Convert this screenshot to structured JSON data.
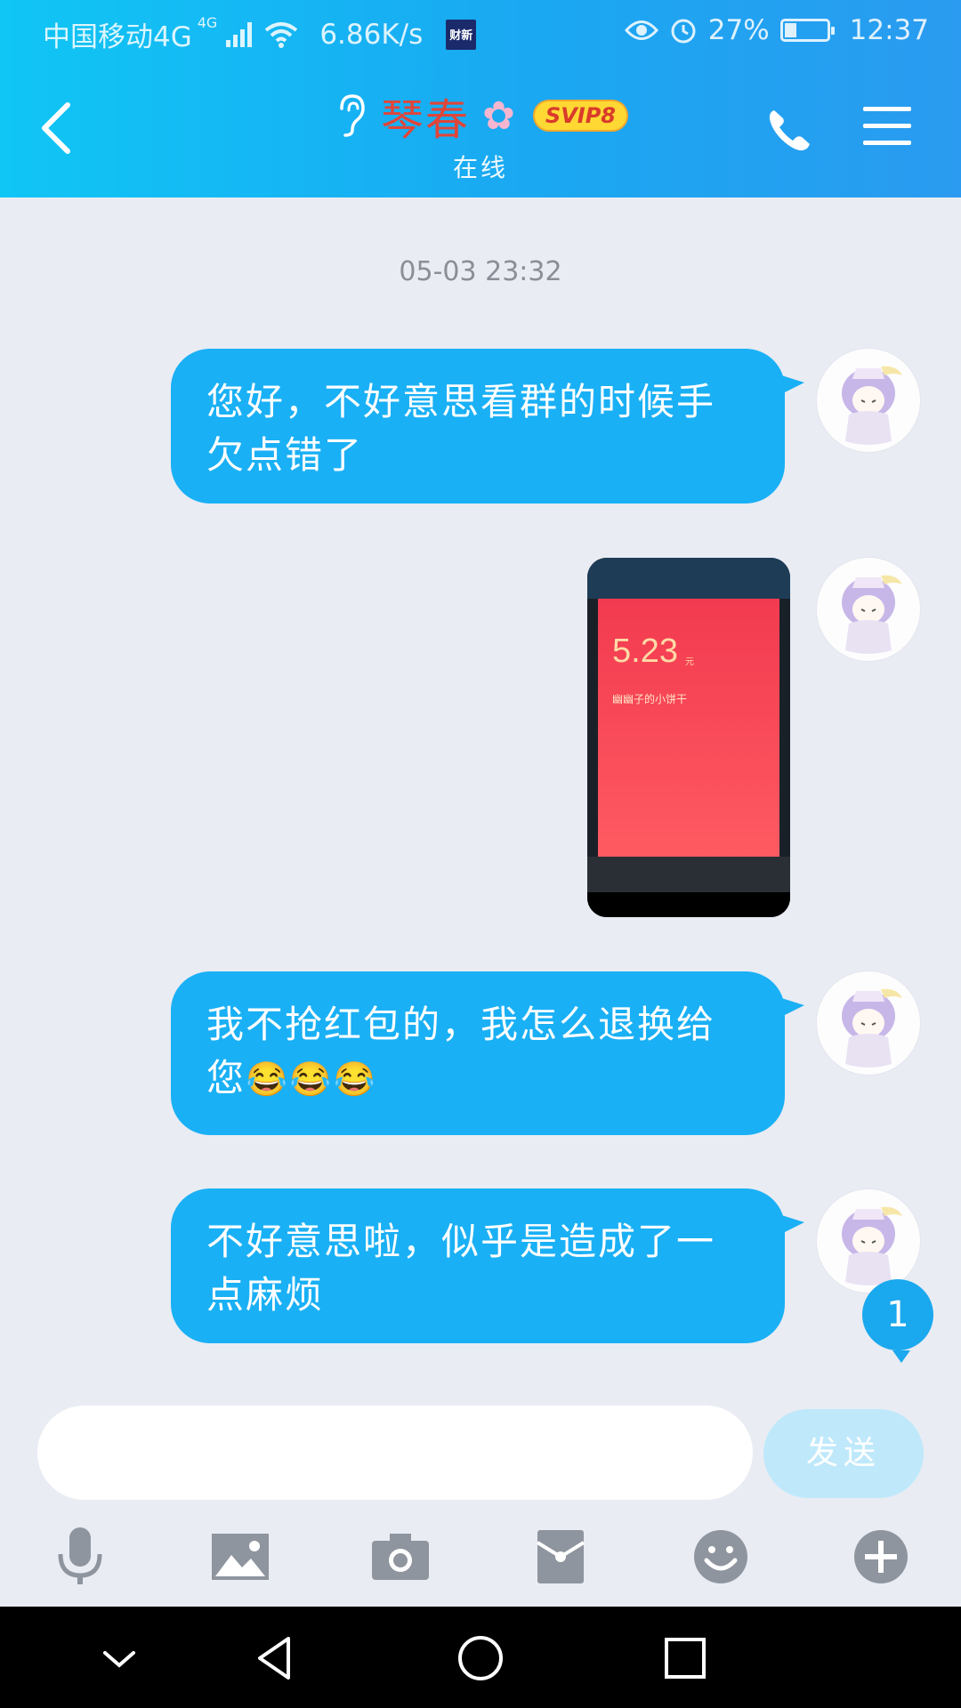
{
  "status_bar": {
    "carrier": "中国移动4G",
    "network_superscript": "4G",
    "speed": "6.86K/s",
    "app_badge": "财新",
    "battery_percent": "27%",
    "time": "12:37"
  },
  "header": {
    "contact_name": "琴春",
    "vip_badge": "SVIP8",
    "presence": "在线"
  },
  "chat": {
    "timestamp": "05-03 23:32",
    "messages": [
      {
        "text": "您好，不好意思看群的时候手欠点错了"
      },
      {
        "type": "image",
        "amount": "5.23",
        "unit": "元",
        "note": "幽幽子的小饼干"
      },
      {
        "text": "我不抢红包的，我怎么退换给您",
        "emojis": "😂😂😂"
      },
      {
        "text": "不好意思啦，似乎是造成了一点麻烦"
      }
    ],
    "unread_count": "1"
  },
  "composer": {
    "input_value": "",
    "send_label": "发送"
  },
  "toolbar": [
    "mic-icon",
    "image-icon",
    "camera-icon",
    "red-packet-icon",
    "emoji-icon",
    "plus-icon"
  ],
  "colors": {
    "header_gradient_start": "#10c6f5",
    "header_gradient_end": "#2a9bf0",
    "bubble": "#1ab0f5",
    "background": "#e9ecf3",
    "send_disabled": "#bfe9fb"
  }
}
